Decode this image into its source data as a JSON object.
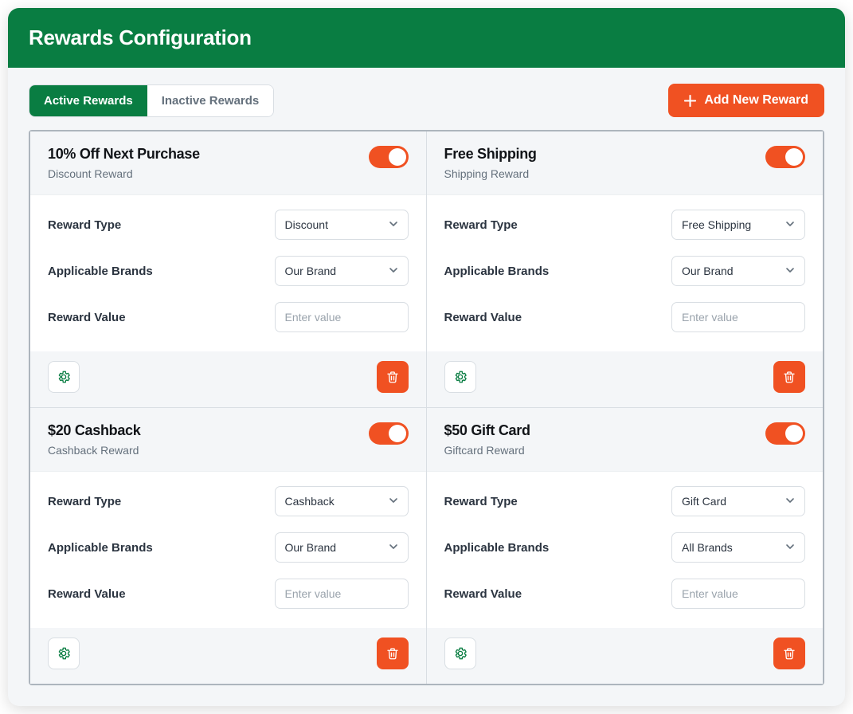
{
  "colors": {
    "brand_green": "#097d42",
    "accent_orange": "#f05122"
  },
  "header": {
    "title": "Rewards Configuration"
  },
  "tabs": {
    "active": "Active Rewards",
    "inactive": "Inactive Rewards"
  },
  "add_button": {
    "label": "Add New Reward"
  },
  "fields": {
    "type_label": "Reward Type",
    "brands_label": "Applicable Brands",
    "value_label": "Reward Value",
    "value_placeholder": "Enter value"
  },
  "cards": [
    {
      "title": "10% Off Next Purchase",
      "subtitle": "Discount Reward",
      "type_value": "Discount",
      "brands_value": "Our Brand",
      "reward_value": ""
    },
    {
      "title": "Free Shipping",
      "subtitle": "Shipping Reward",
      "type_value": "Free Shipping",
      "brands_value": "Our Brand",
      "reward_value": ""
    },
    {
      "title": "$20 Cashback",
      "subtitle": "Cashback Reward",
      "type_value": "Cashback",
      "brands_value": "Our Brand",
      "reward_value": ""
    },
    {
      "title": "$50 Gift Card",
      "subtitle": "Giftcard Reward",
      "type_value": "Gift Card",
      "brands_value": "All Brands",
      "reward_value": ""
    }
  ]
}
